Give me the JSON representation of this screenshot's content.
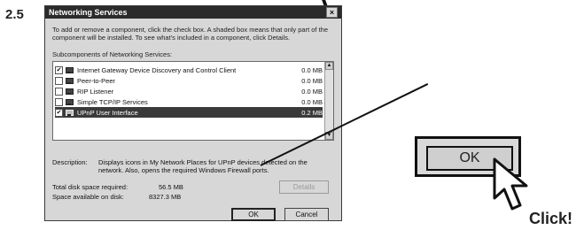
{
  "step_number": "2.5",
  "dialog": {
    "title": "Networking Services",
    "close_glyph": "×",
    "intro": "To add or remove a component, click the check box. A shaded box means that only part of the component will be installed. To see what's included in a component, click Details.",
    "subcomponents_label": "Subcomponents of Networking Services:",
    "components": [
      {
        "name": "Internet Gateway Device Discovery and Control Client",
        "size": "0.0 MB",
        "checked": true,
        "selected": false
      },
      {
        "name": "Peer-to-Peer",
        "size": "0.0 MB",
        "checked": false,
        "selected": false
      },
      {
        "name": "RIP Listener",
        "size": "0.0 MB",
        "checked": false,
        "selected": false
      },
      {
        "name": "Simple TCP/IP Services",
        "size": "0.0 MB",
        "checked": false,
        "selected": false
      },
      {
        "name": "UPnP User Interface",
        "size": "0.2 MB",
        "checked": true,
        "selected": true
      }
    ],
    "description_label": "Description:",
    "description_text": "Displays icons in My Network Places for UPnP devices detected on the network. Also, opens the required Windows Firewall ports.",
    "total_disk_label": "Total disk space required:",
    "total_disk_value": "56.5 MB",
    "available_label": "Space available on disk:",
    "available_value": "8327.3 MB",
    "details_button": "Details",
    "ok_button": "OK",
    "cancel_button": "Cancel"
  },
  "callout": {
    "ok_label": "OK",
    "click_text": "Click!"
  },
  "icons": {
    "checkmark": "✔",
    "scroll_up": "▲",
    "scroll_down": "▼"
  }
}
